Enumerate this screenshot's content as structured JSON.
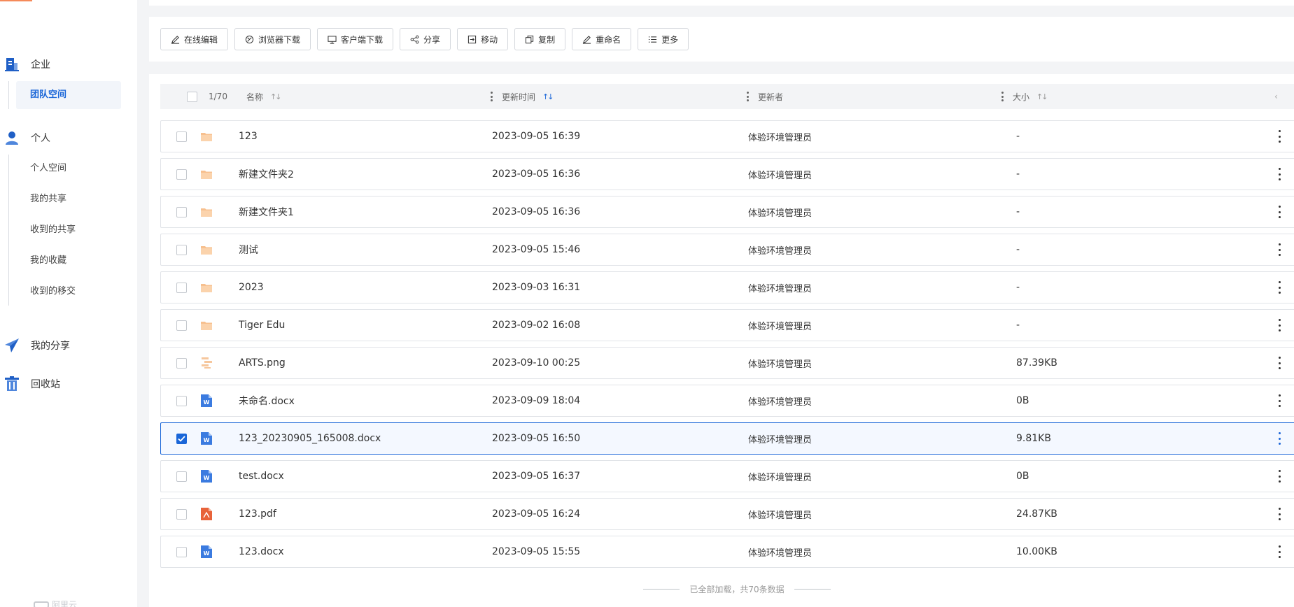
{
  "sidebar": {
    "enterprise": {
      "label": "企业",
      "items": [
        {
          "label": "团队空间",
          "active": true
        }
      ]
    },
    "personal": {
      "label": "个人",
      "items": [
        {
          "label": "个人空间"
        },
        {
          "label": "我的共享"
        },
        {
          "label": "收到的共享"
        },
        {
          "label": "我的收藏"
        },
        {
          "label": "收到的移交"
        }
      ]
    },
    "my_share": {
      "label": "我的分享"
    },
    "recycle": {
      "label": "回收站"
    },
    "footer_logo": "阿里云"
  },
  "toolbar": {
    "online_edit": "在线编辑",
    "browser_download": "浏览器下载",
    "client_download": "客户端下载",
    "share": "分享",
    "move": "移动",
    "copy": "复制",
    "rename": "重命名",
    "more": "更多"
  },
  "table": {
    "selection_count": "1/70",
    "headers": {
      "name": "名称",
      "updated": "更新时间",
      "updater": "更新者",
      "size": "大小"
    },
    "rows": [
      {
        "type": "folder",
        "name": "123",
        "updated": "2023-09-05 16:39",
        "updater": "体验环境管理员",
        "size": "-",
        "checked": false
      },
      {
        "type": "folder",
        "name": "新建文件夹2",
        "updated": "2023-09-05 16:36",
        "updater": "体验环境管理员",
        "size": "-",
        "checked": false
      },
      {
        "type": "folder",
        "name": "新建文件夹1",
        "updated": "2023-09-05 16:36",
        "updater": "体验环境管理员",
        "size": "-",
        "checked": false
      },
      {
        "type": "folder",
        "name": "测试",
        "updated": "2023-09-05 15:46",
        "updater": "体验环境管理员",
        "size": "-",
        "checked": false
      },
      {
        "type": "folder",
        "name": "2023",
        "updated": "2023-09-03 16:31",
        "updater": "体验环境管理员",
        "size": "-",
        "checked": false
      },
      {
        "type": "folder",
        "name": "Tiger Edu",
        "updated": "2023-09-02 16:08",
        "updater": "体验环境管理员",
        "size": "-",
        "checked": false
      },
      {
        "type": "image",
        "name": "ARTS.png",
        "updated": "2023-09-10 00:25",
        "updater": "体验环境管理员",
        "size": "87.39KB",
        "checked": false
      },
      {
        "type": "word",
        "name": "未命名.docx",
        "updated": "2023-09-09 18:04",
        "updater": "体验环境管理员",
        "size": "0B",
        "checked": false
      },
      {
        "type": "word",
        "name": "123_20230905_165008.docx",
        "updated": "2023-09-05 16:50",
        "updater": "体验环境管理员",
        "size": "9.81KB",
        "checked": true
      },
      {
        "type": "word",
        "name": "test.docx",
        "updated": "2023-09-05 16:37",
        "updater": "体验环境管理员",
        "size": "0B",
        "checked": false
      },
      {
        "type": "pdf",
        "name": "123.pdf",
        "updated": "2023-09-05 16:24",
        "updater": "体验环境管理员",
        "size": "24.87KB",
        "checked": false
      },
      {
        "type": "word",
        "name": "123.docx",
        "updated": "2023-09-05 15:55",
        "updater": "体验环境管理员",
        "size": "10.00KB",
        "checked": false
      }
    ]
  },
  "footer_note": "已全部加载，共70条数据",
  "colors": {
    "accent": "#1a66d8",
    "folder": "#f7c08f",
    "pdf": "#e8633a",
    "word": "#3b7be0"
  }
}
